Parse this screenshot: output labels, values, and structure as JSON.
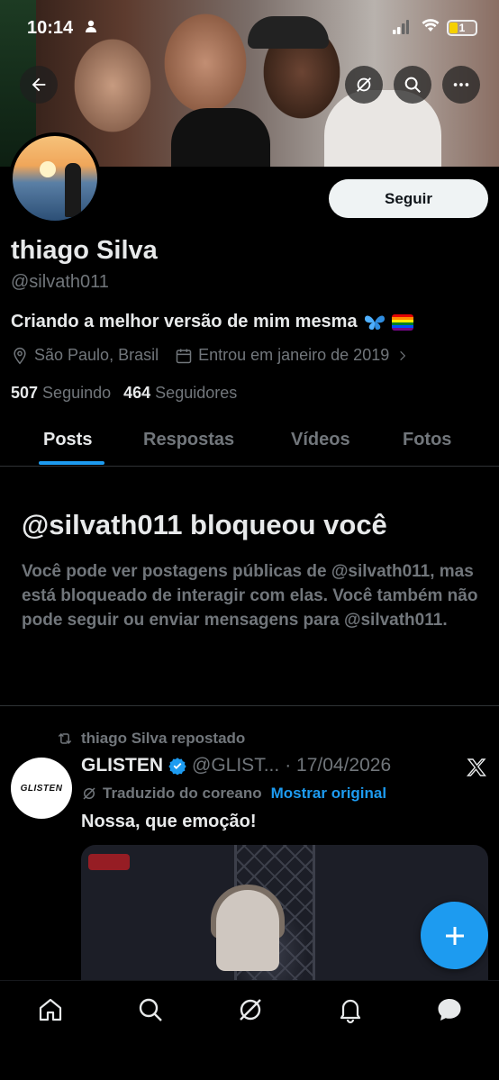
{
  "status_bar": {
    "time": "10:14",
    "battery": "1"
  },
  "profile": {
    "name": "thiago Silva",
    "handle": "@silvath011",
    "bio": "Criando a melhor versão de mim mesma",
    "location": "São Paulo, Brasil",
    "joined": "Entrou em janeiro de 2019",
    "following_count": "507",
    "following_label": "Seguindo",
    "followers_count": "464",
    "followers_label": "Seguidores"
  },
  "follow_button_label": "Seguir",
  "tabs": [
    {
      "label": "Posts",
      "active": true
    },
    {
      "label": "Respostas",
      "active": false
    },
    {
      "label": "Vídeos",
      "active": false
    },
    {
      "label": "Fotos",
      "active": false
    }
  ],
  "blocked": {
    "title": "@silvath011 bloqueou você",
    "text": "Você pode ver postagens públicas de @silvath011, mas está bloqueado de interagir com elas. Você também não pode seguir ou enviar mensagens para @silvath011."
  },
  "post": {
    "repost_label": "thiago Silva repostado",
    "author_name": "GLISTEN",
    "author_handle": "@GLIST...",
    "date": "· 17/04/2026",
    "avatar_text": "GLISTEN",
    "translated_label": "Traduzido do coreano",
    "show_original_label": "Mostrar original",
    "text": "Nossa, que emoção!"
  },
  "colors": {
    "accent": "#1d9bf0",
    "muted": "#71767b",
    "text": "#e7e9ea",
    "background": "#000000"
  },
  "icons": {
    "back": "arrow-left-icon",
    "grok": "grok-icon",
    "search": "search-icon",
    "more": "more-icon",
    "location": "location-pin-icon",
    "calendar": "calendar-icon",
    "repost": "repost-icon",
    "verified": "verified-badge-icon",
    "x": "x-logo-icon",
    "compose": "plus-icon",
    "nav": [
      "home-icon",
      "search-icon",
      "grok-icon",
      "bell-icon",
      "messages-icon"
    ]
  }
}
